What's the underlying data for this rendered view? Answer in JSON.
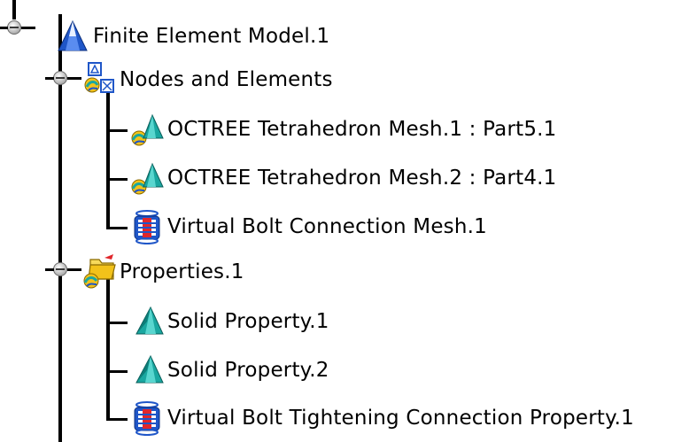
{
  "tree": {
    "root": {
      "label": "Finite Element Model.1",
      "icon": "fem-model-icon"
    },
    "groups": [
      {
        "label": "Nodes and Elements",
        "icon": "nodes-elements-icon",
        "children": [
          {
            "label": "OCTREE Tetrahedron Mesh.1 : Part5.1",
            "icon": "octree-mesh-icon"
          },
          {
            "label": "OCTREE Tetrahedron Mesh.2 : Part4.1",
            "icon": "octree-mesh-icon"
          },
          {
            "label": "Virtual Bolt Connection Mesh.1",
            "icon": "virtual-bolt-icon"
          }
        ]
      },
      {
        "label": "Properties.1",
        "icon": "properties-folder-icon",
        "children": [
          {
            "label": "Solid Property.1",
            "icon": "solid-property-icon"
          },
          {
            "label": "Solid Property.2",
            "icon": "solid-property-icon"
          },
          {
            "label": "Virtual Bolt Tightening Connection Property.1",
            "icon": "virtual-bolt-icon"
          }
        ]
      }
    ]
  },
  "colors": {
    "tree_line": "#000000",
    "mesh_teal": "#1aa7a0",
    "model_blue": "#1f56c8",
    "folder_yellow": "#f2c21a"
  }
}
